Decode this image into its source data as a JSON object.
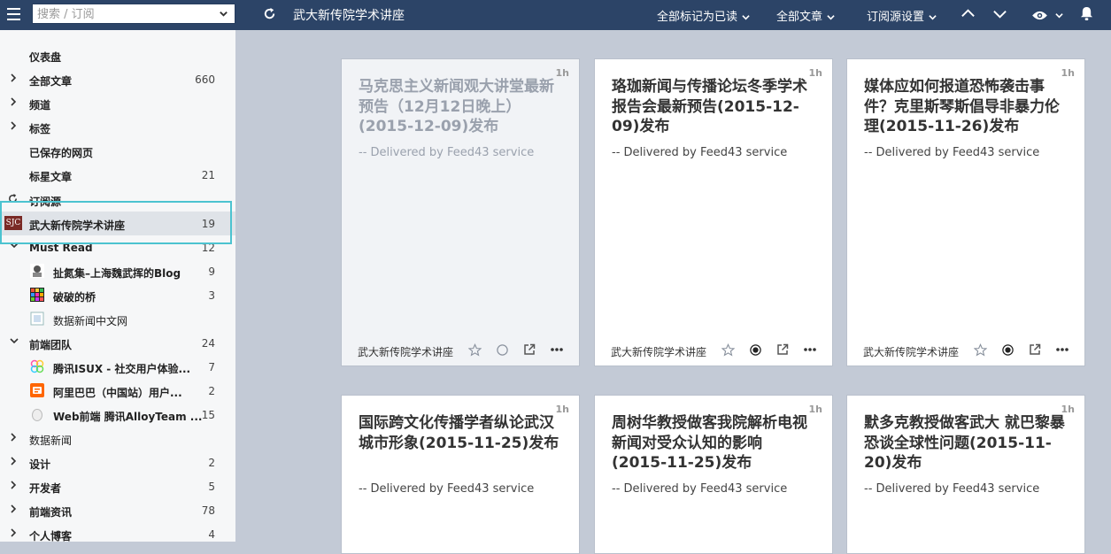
{
  "topbar": {
    "search_placeholder": "搜索 / 订阅",
    "feed_title": "武大新传院学术讲座",
    "mark_all_read": "全部标记为已读",
    "all_articles": "全部文章",
    "feed_settings": "订阅源设置"
  },
  "sidebar": {
    "dashboard": "仪表盘",
    "all_articles": {
      "label": "全部文章",
      "count": "660"
    },
    "channels": "频道",
    "tags": "标签",
    "saved_pages": "已保存的网页",
    "starred": {
      "label": "标星文章",
      "count": "21"
    },
    "subscriptions": "订阅源",
    "selected_feed": {
      "label": "武大新传院学术讲座",
      "count": "19",
      "logo_text": "SJC"
    },
    "must_read": {
      "label": "Must Read",
      "count": "12"
    },
    "must_read_feeds": [
      {
        "label": "扯氮集–上海魏武挥的Blog",
        "count": "9"
      },
      {
        "label": "破破的桥",
        "count": "3"
      },
      {
        "label": "数据新闻中文网",
        "count": ""
      }
    ],
    "frontend_team": {
      "label": "前端团队",
      "count": "24"
    },
    "frontend_feeds": [
      {
        "label": "腾讯ISUX - 社交用户体验...",
        "count": "7"
      },
      {
        "label": "阿里巴巴（中国站）用户...",
        "count": "2"
      },
      {
        "label": "Web前端 腾讯AlloyTeam ...",
        "count": "15"
      }
    ],
    "data_news": {
      "label": "数据新闻",
      "count": ""
    },
    "design": {
      "label": "设计",
      "count": "2"
    },
    "developers": {
      "label": "开发者",
      "count": "5"
    },
    "frontend_news": {
      "label": "前端资讯",
      "count": "78"
    },
    "personal_blogs": {
      "label": "个人博客",
      "count": "4"
    }
  },
  "cards": [
    {
      "age": "1h",
      "title": "马克思主义新闻观大讲堂最新预告（12月12日晚上）(2015-12-09)发布",
      "snippet": "-- Delivered by Feed43 service",
      "source": "武大新传院学术讲座",
      "read": true
    },
    {
      "age": "1h",
      "title": "珞珈新闻与传播论坛冬季学术报告会最新预告(2015-12-09)发布",
      "snippet": "-- Delivered by Feed43 service",
      "source": "武大新传院学术讲座",
      "read": false
    },
    {
      "age": "1h",
      "title": "媒体应如何报道恐怖袭击事件？克里斯琴斯倡导非暴力伦理(2015-11-26)发布",
      "snippet": "-- Delivered by Feed43 service",
      "source": "武大新传院学术讲座",
      "read": false
    },
    {
      "age": "1h",
      "title": "国际跨文化传播学者纵论武汉城市形象(2015-11-25)发布",
      "snippet": "-- Delivered by Feed43 service",
      "source": "",
      "read": false
    },
    {
      "age": "1h",
      "title": "周树华教授做客我院解析电视新闻对受众认知的影响(2015-11-25)发布",
      "snippet": "-- Delivered by Feed43 service",
      "source": "",
      "read": false
    },
    {
      "age": "1h",
      "title": "默多克教授做客武大 就巴黎暴恐谈全球性问题(2015-11-20)发布",
      "snippet": "-- Delivered by Feed43 service",
      "source": "",
      "read": false
    }
  ],
  "colors": {
    "topbar": "#2c4467",
    "background": "#c3cad6",
    "highlight": "#4cc3d0",
    "read_title": "#9aa1ad"
  }
}
